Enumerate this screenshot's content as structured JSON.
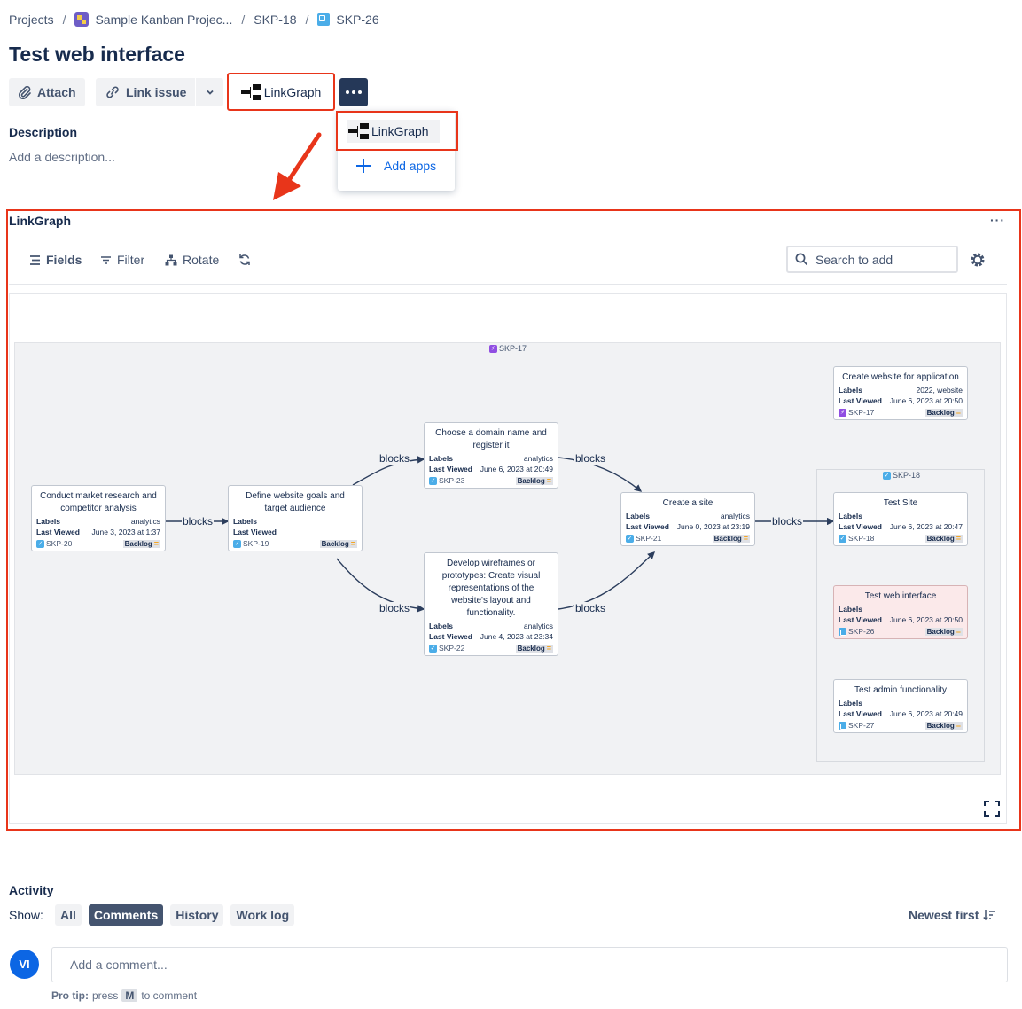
{
  "breadcrumb": {
    "projects": "Projects",
    "project": "Sample Kanban Projec...",
    "parent": "SKP-18",
    "current": "SKP-26"
  },
  "issue_title": "Test web interface",
  "toolbar": {
    "attach": "Attach",
    "link_issue": "Link issue",
    "linkgraph": "LinkGraph"
  },
  "dropdown": {
    "linkgraph": "LinkGraph",
    "add_apps": "Add apps"
  },
  "description": {
    "heading": "Description",
    "placeholder": "Add a description..."
  },
  "panel": {
    "title": "LinkGraph",
    "fields": "Fields",
    "filter": "Filter",
    "rotate": "Rotate",
    "search_placeholder": "Search to add"
  },
  "graph": {
    "outer_group": "SKP-17",
    "inner_group": "SKP-18",
    "edge_label": "blocks",
    "label_labels": "Labels",
    "label_last_viewed": "Last Viewed",
    "status": "Backlog",
    "cards": [
      {
        "title": "Conduct market research and competitor analysis",
        "labels": "analytics",
        "last_viewed": "June 3, 2023 at 1:37",
        "key": "SKP-20"
      },
      {
        "title": "Define website goals and target audience",
        "labels": "",
        "last_viewed": "",
        "key": "SKP-19"
      },
      {
        "title": "Choose a domain name and register it",
        "labels": "analytics",
        "last_viewed": "June 6, 2023 at 20:49",
        "key": "SKP-23"
      },
      {
        "title": "Develop wireframes or prototypes: Create visual representations of the website's layout and functionality.",
        "labels": "analytics",
        "last_viewed": "June 4, 2023 at 23:34",
        "key": "SKP-22"
      },
      {
        "title": "Create a site",
        "labels": "analytics",
        "last_viewed": "June 0, 2023 at 23:19",
        "key": "SKP-21"
      },
      {
        "title": "Create website for application",
        "labels": "2022, website",
        "last_viewed": "June 6, 2023 at 20:50",
        "key": "SKP-17"
      },
      {
        "title": "Test Site",
        "labels": "",
        "last_viewed": "June 6, 2023 at 20:47",
        "key": "SKP-18"
      },
      {
        "title": "Test web interface",
        "labels": "",
        "last_viewed": "June 6, 2023 at 20:50",
        "key": "SKP-26"
      },
      {
        "title": "Test admin functionality",
        "labels": "",
        "last_viewed": "June 6, 2023 at 20:49",
        "key": "SKP-27"
      }
    ]
  },
  "activity": {
    "heading": "Activity",
    "show_label": "Show:",
    "filters": [
      "All",
      "Comments",
      "History",
      "Work log"
    ],
    "active_filter": "Comments",
    "sort": "Newest first",
    "avatar": "VI",
    "comment_placeholder": "Add a comment...",
    "pro_tip_prefix": "Pro tip:",
    "pro_tip_press": "press",
    "pro_tip_key": "M",
    "pro_tip_suffix": "to comment"
  },
  "colors": {
    "annotation_red": "#e8351a",
    "accent_blue": "#0c66e4",
    "dark_button": "#253858",
    "highlight_card": "#fbe9ea"
  }
}
